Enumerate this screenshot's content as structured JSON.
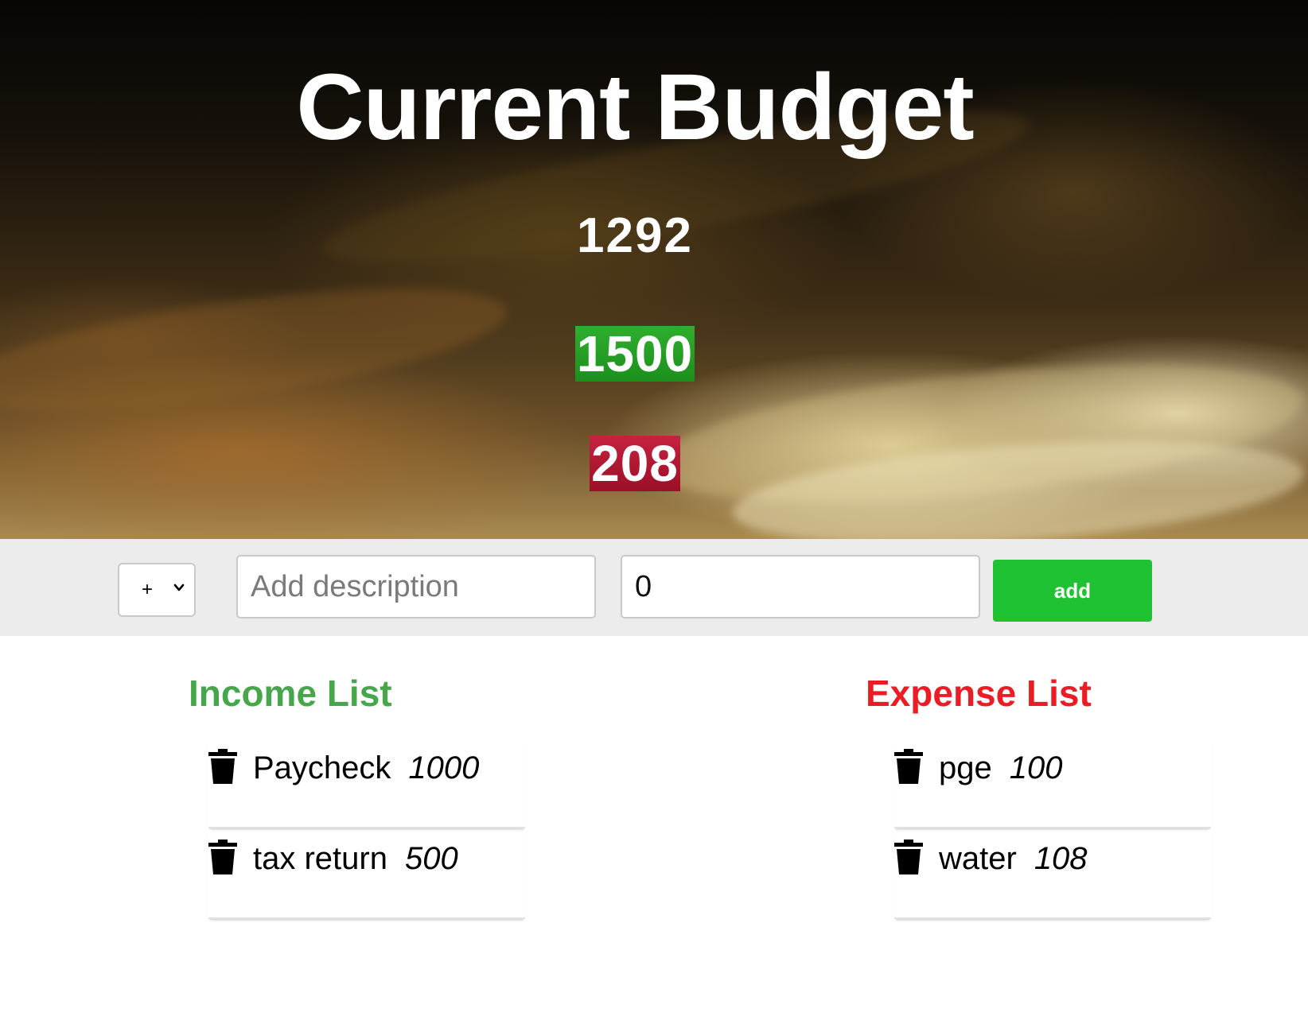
{
  "header": {
    "title": "Current Budget",
    "total": "1292",
    "income_total": "1500",
    "expense_total": "208"
  },
  "controls": {
    "type_select": {
      "selected": "+",
      "options": [
        "+",
        "-"
      ]
    },
    "description_placeholder": "Add description",
    "amount_value": "0",
    "add_label": "add"
  },
  "income": {
    "title": "Income List",
    "items": [
      {
        "description": "Paycheck",
        "amount": "1000"
      },
      {
        "description": "tax return",
        "amount": "500"
      }
    ]
  },
  "expense": {
    "title": "Expense List",
    "items": [
      {
        "description": "pge",
        "amount": "100"
      },
      {
        "description": "water",
        "amount": "108"
      }
    ]
  },
  "colors": {
    "income_accent": "#46a64a",
    "expense_accent": "#ec1c24",
    "add_button": "#1fc233",
    "income_badge": "#1f9a1f",
    "expense_badge": "#b0152f"
  },
  "icons": {
    "delete": "trash-icon",
    "select_arrow": "chevron-down-icon"
  }
}
